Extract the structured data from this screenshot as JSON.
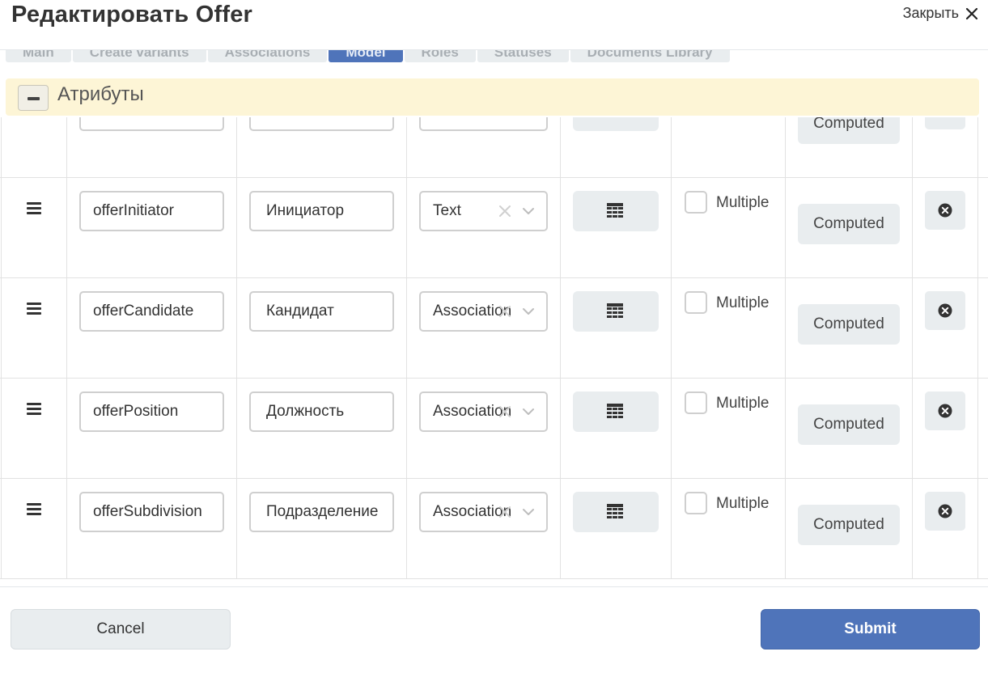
{
  "header": {
    "title": "Редактировать Offer",
    "close_label": "Закрыть"
  },
  "tabs": [
    {
      "label": "Main",
      "active": false
    },
    {
      "label": "Create variants",
      "active": false
    },
    {
      "label": "Associations",
      "active": false
    },
    {
      "label": "Model",
      "active": true
    },
    {
      "label": "Roles",
      "active": false
    },
    {
      "label": "Statuses",
      "active": false
    },
    {
      "label": "Documents Library",
      "active": false
    }
  ],
  "section": {
    "title": "Атрибуты"
  },
  "attributes": {
    "multiple_label": "Multiple",
    "computed_label": "Computed",
    "rows": [
      {
        "code": "",
        "label": "",
        "type": "",
        "multiple": false,
        "partial": true
      },
      {
        "code": "offerInitiator",
        "label": "Инициатор",
        "type": "Text",
        "multiple": false
      },
      {
        "code": "offerCandidate",
        "label": "Кандидат",
        "type": "Association",
        "multiple": false
      },
      {
        "code": "offerPosition",
        "label": "Должность",
        "type": "Association",
        "multiple": false
      },
      {
        "code": "offerSubdivision",
        "label": "Подразделение",
        "type": "Association",
        "multiple": false
      }
    ]
  },
  "footer": {
    "cancel_label": "Cancel",
    "submit_label": "Submit"
  },
  "colors": {
    "accent": "#4f74ba",
    "section_bg": "#fdf5d6",
    "button_bg": "#e9edef"
  },
  "icons": {
    "close": "close-icon",
    "collapse": "minus-icon",
    "drag": "drag-handle-icon",
    "grid": "table-icon",
    "clear": "clear-icon",
    "chevron": "chevron-down-icon",
    "remove": "remove-circle-icon"
  }
}
